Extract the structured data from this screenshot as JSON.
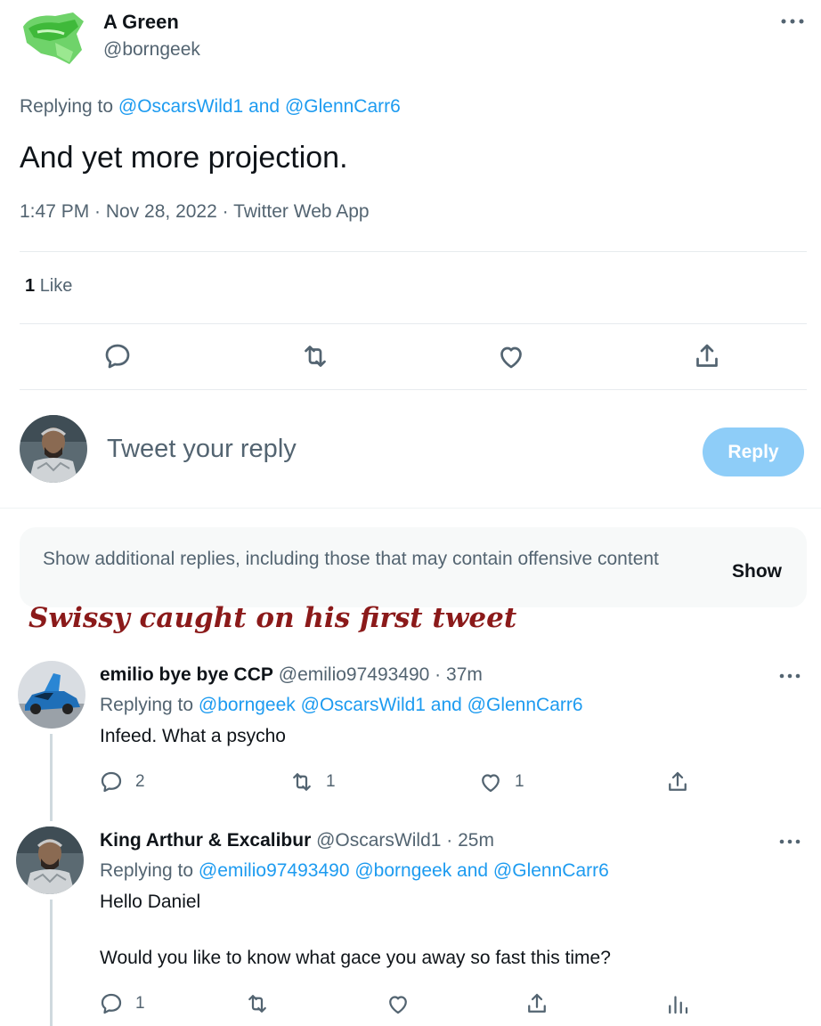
{
  "main_tweet": {
    "display_name": "A Green",
    "handle": "@borngeek",
    "replying_prefix": "Replying to",
    "replying_mentions": "@OscarsWild1 and @GlennCarr6",
    "text": "And yet more projection.",
    "meta": "1:47 PM · Nov 28, 2022 · Twitter Web App",
    "like_count": "1",
    "like_label": "Like"
  },
  "composer": {
    "placeholder": "Tweet your reply",
    "reply_button": "Reply"
  },
  "additional_replies": {
    "text": "Show additional replies, including those that may contain offensive content",
    "show_button": "Show"
  },
  "annotation": "Swissy caught on his first tweet",
  "replies": [
    {
      "display_name": "emilio bye bye CCP",
      "handle_time": "@emilio97493490 · 37m",
      "replying_prefix": "Replying to",
      "replying_mentions": "@borngeek @OscarsWild1 and @GlennCarr6",
      "text_lines": [
        "Infeed. What a psycho"
      ],
      "reply_count": "2",
      "retweet_count": "1",
      "like_count": "1"
    },
    {
      "display_name": "King Arthur & Excalibur",
      "handle_time": "@OscarsWild1 · 25m",
      "replying_prefix": "Replying to",
      "replying_mentions": "@emilio97493490 @borngeek and @GlennCarr6",
      "text_lines": [
        "Hello Daniel",
        "Would you like to know what gace you away so fast this time?"
      ],
      "reply_count": "1"
    }
  ],
  "colors": {
    "accent": "#1d9bf0",
    "reply_button_disabled": "#8ecdf8",
    "secondary_text": "#536471",
    "annotation": "#8b1a1a"
  },
  "icons": [
    "green-car-avatar",
    "more-icon",
    "reply-icon",
    "retweet-icon",
    "like-icon",
    "share-icon",
    "analytics-icon",
    "knight-avatar",
    "sports-car-avatar"
  ]
}
